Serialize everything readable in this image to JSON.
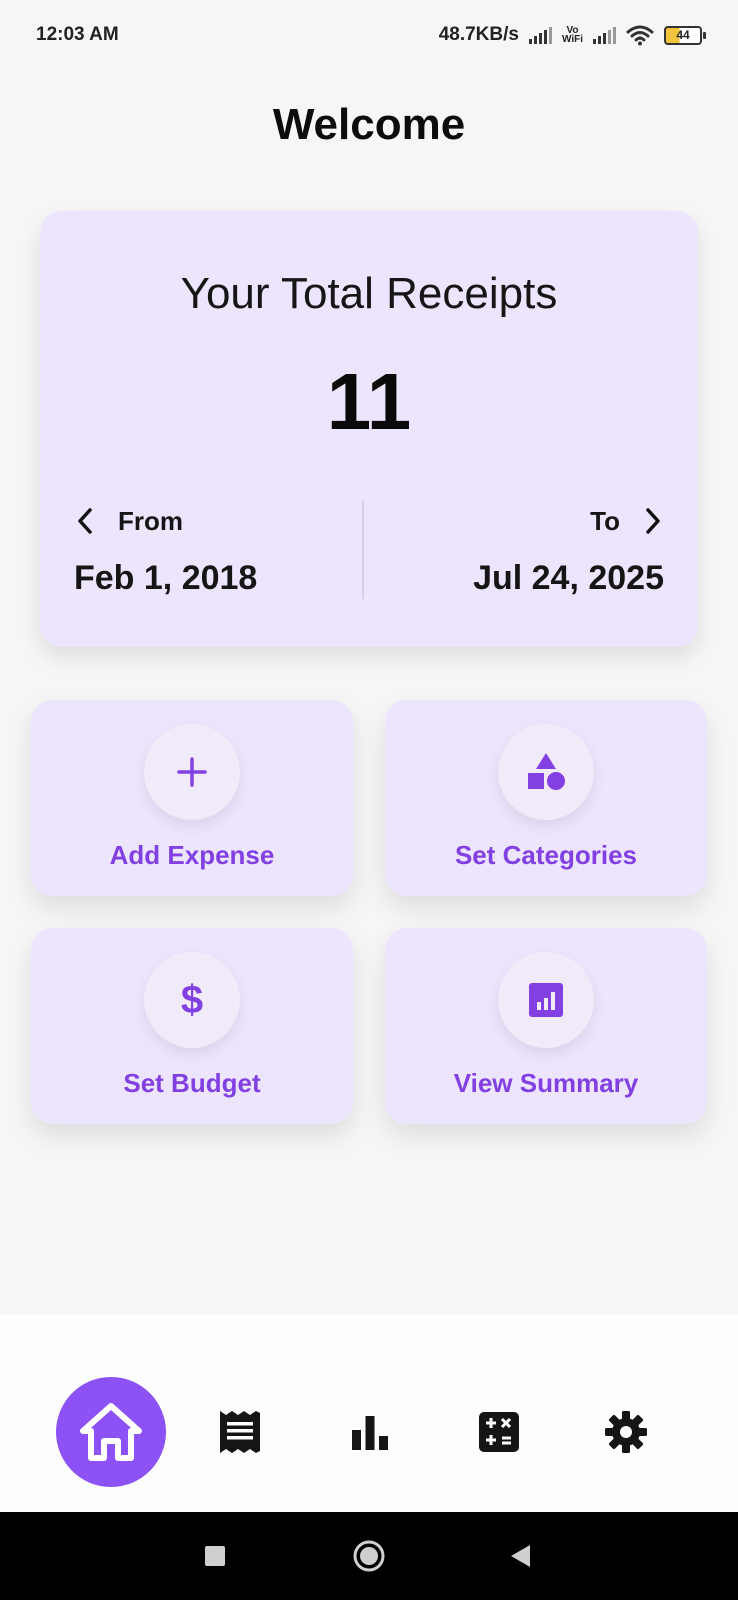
{
  "status_bar": {
    "time": "12:03 AM",
    "network_speed": "48.7KB/s",
    "vowifi_top": "Vo",
    "vowifi_bottom": "WiFi",
    "battery": "44"
  },
  "page": {
    "title": "Welcome"
  },
  "receipts_card": {
    "title": "Your Total Receipts",
    "count": "11",
    "from_label": "From",
    "from_date": "Feb 1, 2018",
    "to_label": "To",
    "to_date": "Jul 24, 2025"
  },
  "actions": [
    {
      "label": "Add Expense",
      "icon": "plus-icon"
    },
    {
      "label": "Set Categories",
      "icon": "shapes-icon"
    },
    {
      "label": "Set Budget",
      "icon": "dollar-icon"
    },
    {
      "label": "View Summary",
      "icon": "bar-chart-icon"
    }
  ],
  "bottom_nav": {
    "items": [
      "home-icon",
      "receipt-icon",
      "chart-icon",
      "calculator-icon",
      "gear-icon"
    ],
    "active": "home-icon"
  },
  "colors": {
    "accent": "#8c52f5",
    "accent_text": "#8240e3",
    "card_bg": "#ede4fd",
    "page_bg": "#f6f6f7"
  }
}
